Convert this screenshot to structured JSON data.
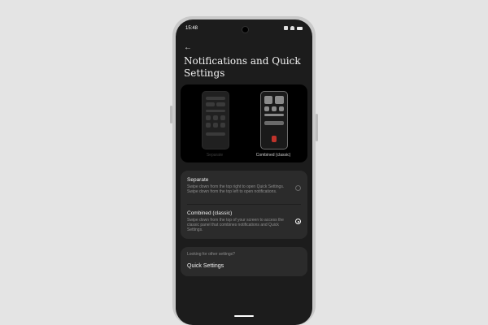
{
  "status_bar": {
    "time": "15:48"
  },
  "header": {
    "back_icon": "arrow-left-icon",
    "title": "Notifications and Quick Settings"
  },
  "preview": {
    "separate_label": "Separate",
    "combined_label": "Combined (classic)"
  },
  "options": [
    {
      "title": "Separate",
      "description": "Swipe down from the top right to open Quick Settings. Swipe down from the top left to open notifications.",
      "selected": false
    },
    {
      "title": "Combined (classic)",
      "description": "Swipe down from the top of your screen to access the classic panel that combines notifications and Quick Settings.",
      "selected": true
    }
  ],
  "other_settings": {
    "hint": "Looking for other settings?",
    "link": "Quick Settings"
  },
  "colors": {
    "background": "#e4e4e4",
    "screen": "#1c1c1c",
    "card": "#2b2b2b",
    "accent_red": "#c0332b"
  }
}
